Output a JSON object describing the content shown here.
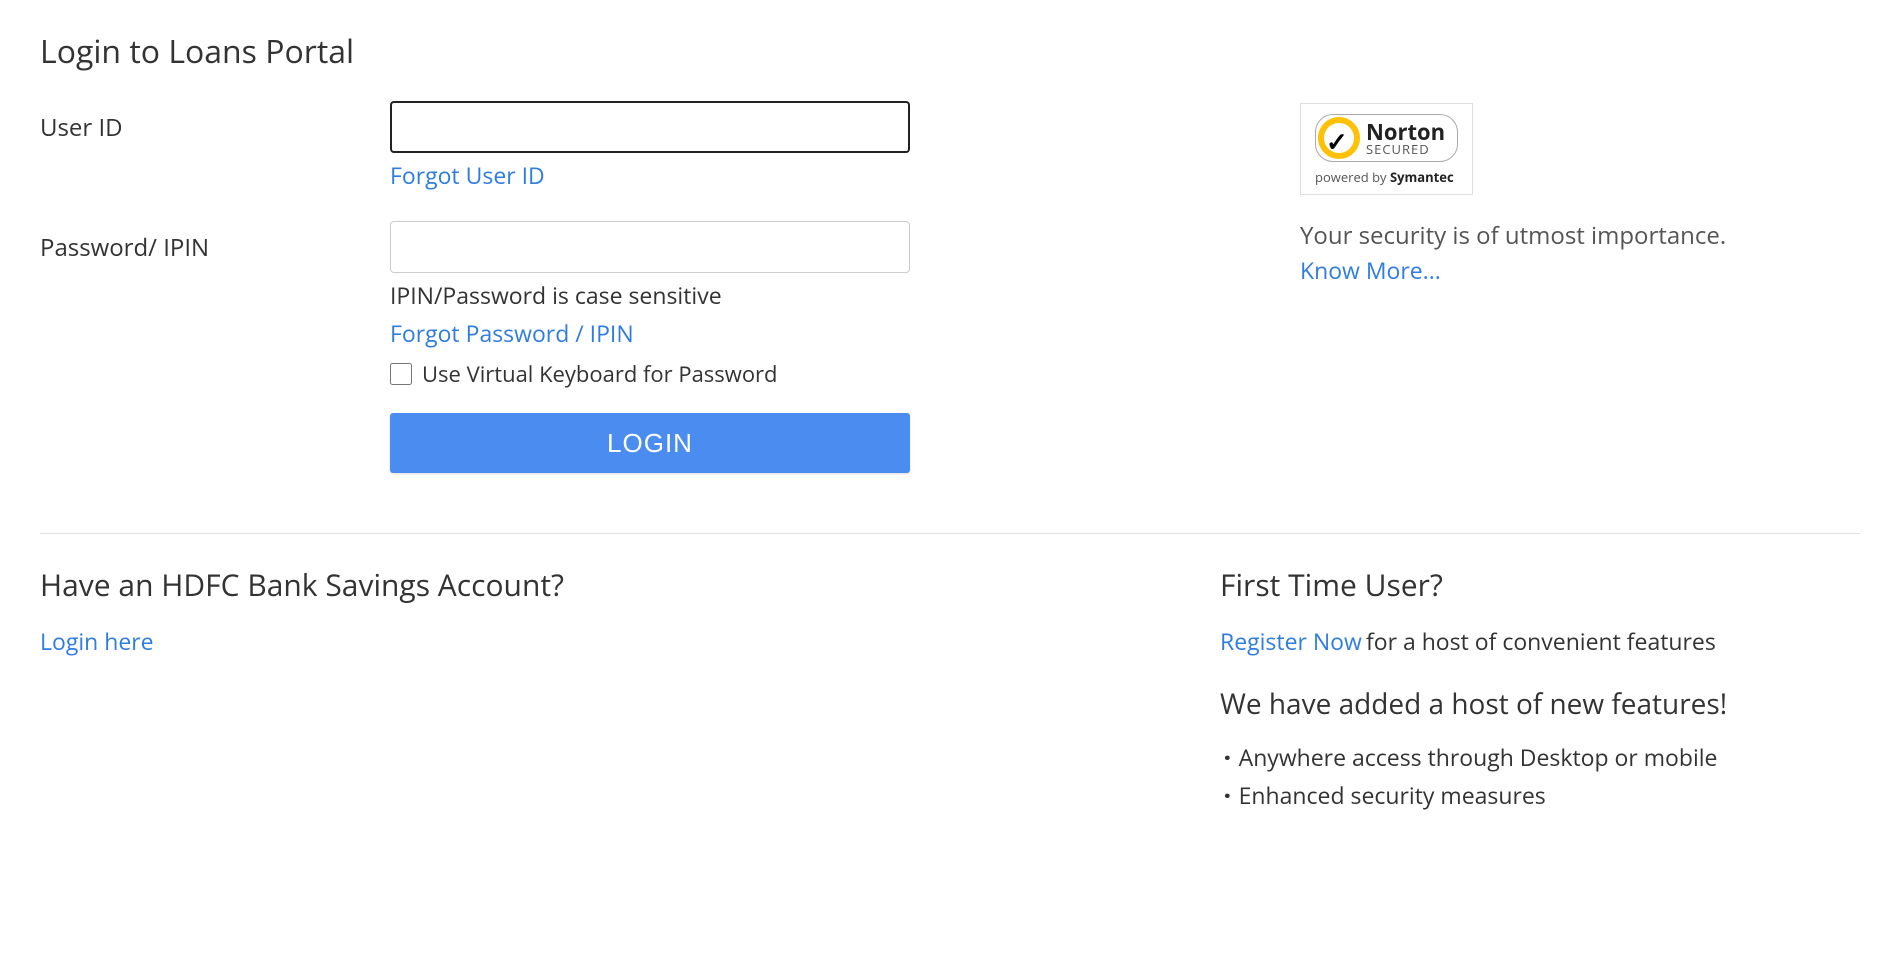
{
  "page": {
    "title": "Login to Loans Portal"
  },
  "form": {
    "userid": {
      "label": "User ID",
      "value": "",
      "forgot": "Forgot User ID"
    },
    "password": {
      "label": "Password/ IPIN",
      "value": "",
      "hint": "IPIN/Password is case sensitive",
      "forgot": "Forgot Password / IPIN",
      "virtual_kb": "Use Virtual Keyboard for Password"
    },
    "login_button": "LOGIN"
  },
  "security": {
    "badge": {
      "brand": "Norton",
      "status": "SECURED",
      "powered_by_prefix": "powered by ",
      "powered_by_brand": "Symantec"
    },
    "message": "Your security is of utmost importance.",
    "know_more": "Know More..."
  },
  "savings": {
    "title": "Have an HDFC Bank Savings Account?",
    "login_here": "Login here"
  },
  "first_time": {
    "title": "First Time User?",
    "register_now": "Register Now",
    "register_suffix": " for a host of convenient features",
    "features_title": "We have added a host of new features!",
    "features": [
      "Anywhere access through Desktop or mobile",
      "Enhanced security measures"
    ]
  }
}
